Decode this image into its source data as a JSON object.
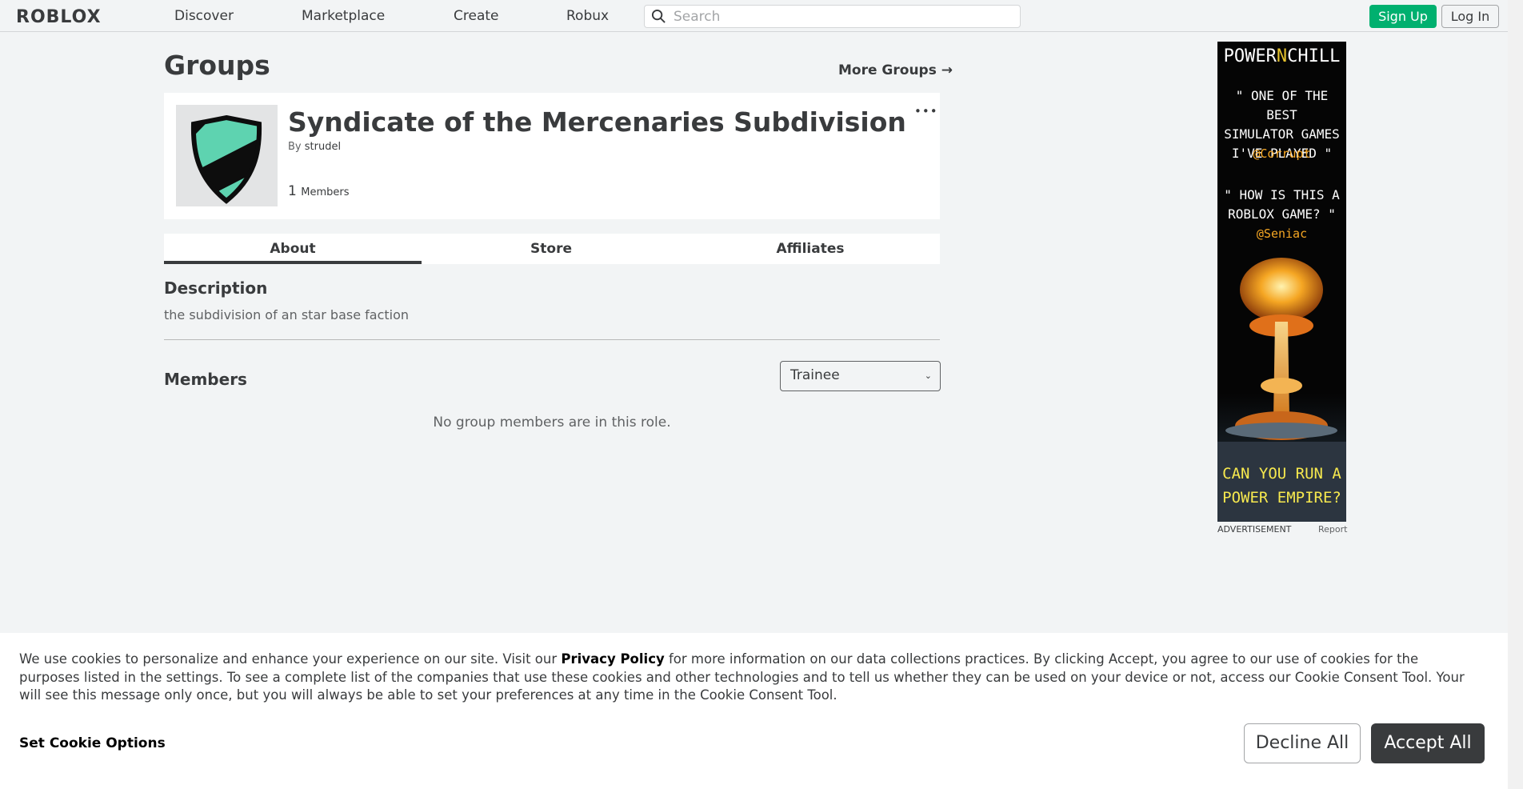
{
  "nav": {
    "logo": "ROBLOX",
    "links": [
      "Discover",
      "Marketplace",
      "Create",
      "Robux"
    ],
    "search_placeholder": "Search",
    "signup_label": "Sign Up",
    "login_label": "Log In"
  },
  "page": {
    "title": "Groups",
    "more_groups": "More Groups →"
  },
  "group": {
    "name": "Syndicate of the Mercenaries Subdivision",
    "by_prefix": "By",
    "owner": "strudel",
    "member_count": "1",
    "members_label": "Members",
    "more_icon": "•••"
  },
  "tabs": [
    {
      "label": "About",
      "active": true
    },
    {
      "label": "Store",
      "active": false
    },
    {
      "label": "Affiliates",
      "active": false
    }
  ],
  "about": {
    "description_title": "Description",
    "description": "the subdivision of an star base faction",
    "members_title": "Members",
    "role_selected": "Trainee",
    "empty_message": "No group members are in this role."
  },
  "ad": {
    "brand_prefix": "POWER",
    "brand_n": "N",
    "brand_suffix": "CHILL",
    "quote1": "\" ONE OF THE BEST\nSIMULATOR GAMES\nI'VE PLAYED \"",
    "handle1": "@Corrupt",
    "quote2": "\" HOW IS THIS A\nROBLOX GAME? \"",
    "handle2": "@Seniac",
    "cta": "CAN YOU RUN A\nPOWER EMPIRE?",
    "label": "ADVERTISEMENT",
    "report": "Report"
  },
  "cookie": {
    "text_before": "We use cookies to personalize and enhance your experience on our site. Visit our ",
    "policy_link": "Privacy Policy",
    "text_after": " for more information on our data collections practices. By clicking Accept, you agree to our use of cookies for the purposes listed in the settings. To see a complete list of the companies that use these cookies and other technologies and to tell us whether they can be used on your device or not, access our Cookie Consent Tool. Your will see this message only once, but you will always be able to set your preferences at any time in the Cookie Consent Tool.",
    "set_options": "Set Cookie Options",
    "decline": "Decline All",
    "accept": "Accept All"
  },
  "colors": {
    "signup_green": "#00b06f",
    "accept_dark": "#393b3d",
    "shield_teal": "#5ed3b0"
  }
}
